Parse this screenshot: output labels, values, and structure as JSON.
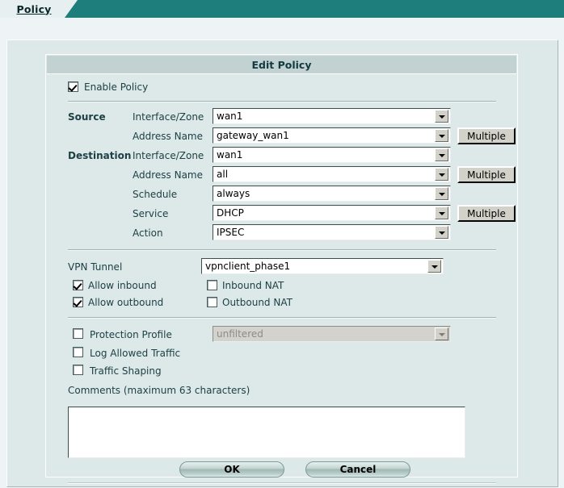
{
  "tab": {
    "label": "Policy"
  },
  "dialog": {
    "title": "Edit Policy"
  },
  "enable": {
    "label": "Enable Policy",
    "checked": true
  },
  "source": {
    "group_label": "Source",
    "interface_label": "Interface/Zone",
    "interface_value": "wan1",
    "address_label": "Address Name",
    "address_value": "gateway_wan1",
    "address_multiple_label": "Multiple"
  },
  "destination": {
    "group_label": "Destination",
    "interface_label": "Interface/Zone",
    "interface_value": "wan1",
    "address_label": "Address Name",
    "address_value": "all",
    "address_multiple_label": "Multiple",
    "schedule_label": "Schedule",
    "schedule_value": "always",
    "service_label": "Service",
    "service_value": "DHCP",
    "service_multiple_label": "Multiple",
    "action_label": "Action",
    "action_value": "IPSEC"
  },
  "vpn": {
    "tunnel_label": "VPN Tunnel",
    "tunnel_value": "vpnclient_phase1",
    "allow_inbound_label": "Allow inbound",
    "allow_inbound_checked": true,
    "allow_outbound_label": "Allow outbound",
    "allow_outbound_checked": true,
    "inbound_nat_label": "Inbound NAT",
    "inbound_nat_checked": false,
    "outbound_nat_label": "Outbound NAT",
    "outbound_nat_checked": false
  },
  "options": {
    "protection_profile_label": "Protection Profile",
    "protection_profile_checked": false,
    "protection_profile_value": "unfiltered",
    "protection_profile_disabled": true,
    "log_allowed_traffic_label": "Log Allowed Traffic",
    "log_allowed_traffic_checked": false,
    "traffic_shaping_label": "Traffic Shaping",
    "traffic_shaping_checked": false
  },
  "comments": {
    "label": "Comments (maximum 63 characters)",
    "value": "",
    "placeholder": ""
  },
  "buttons": {
    "ok_label": "OK",
    "cancel_label": "Cancel"
  },
  "colors": {
    "tab_teal": "#1d7e7c",
    "panel": "#dde9e9",
    "title_bar": "#c2d2d2"
  }
}
